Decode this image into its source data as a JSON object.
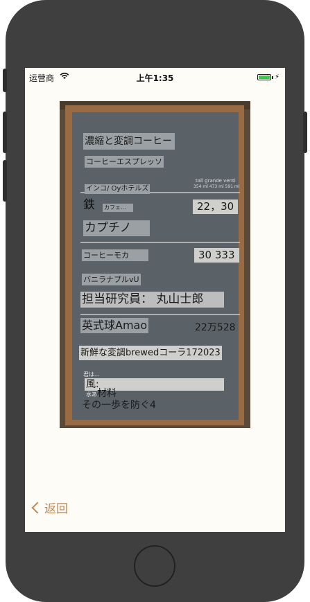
{
  "status": {
    "carrier": "运营商",
    "time": "上午1:35"
  },
  "menu": {
    "heading1": "濃縮と変調コーヒー",
    "heading2": "コーヒーエスプレッソ",
    "section": "インコ/ Oyホテルズ",
    "sizes": "tall grande venti",
    "sizes_ml": "354 ml 473 ml 591 ml",
    "iron": "鉄",
    "iron_note": "カフェ...",
    "price1": "22，30",
    "cappuccino": "カプチノ",
    "mocha": "コーヒーモカ",
    "price2": "30 333",
    "vanilla": "バニラナプルvU",
    "researcher": "担当研究員： 丸山士郎",
    "english": "英式球Amao",
    "price3": "22万528",
    "fresh": "新鮮な変調brewedコーラ172023",
    "small1": "君は...",
    "wind": "風:",
    "small2": "水あ",
    "ingredients": "材料",
    "prevent": "その一歩を防ぐ4"
  },
  "nav": {
    "back_label": "返回"
  }
}
